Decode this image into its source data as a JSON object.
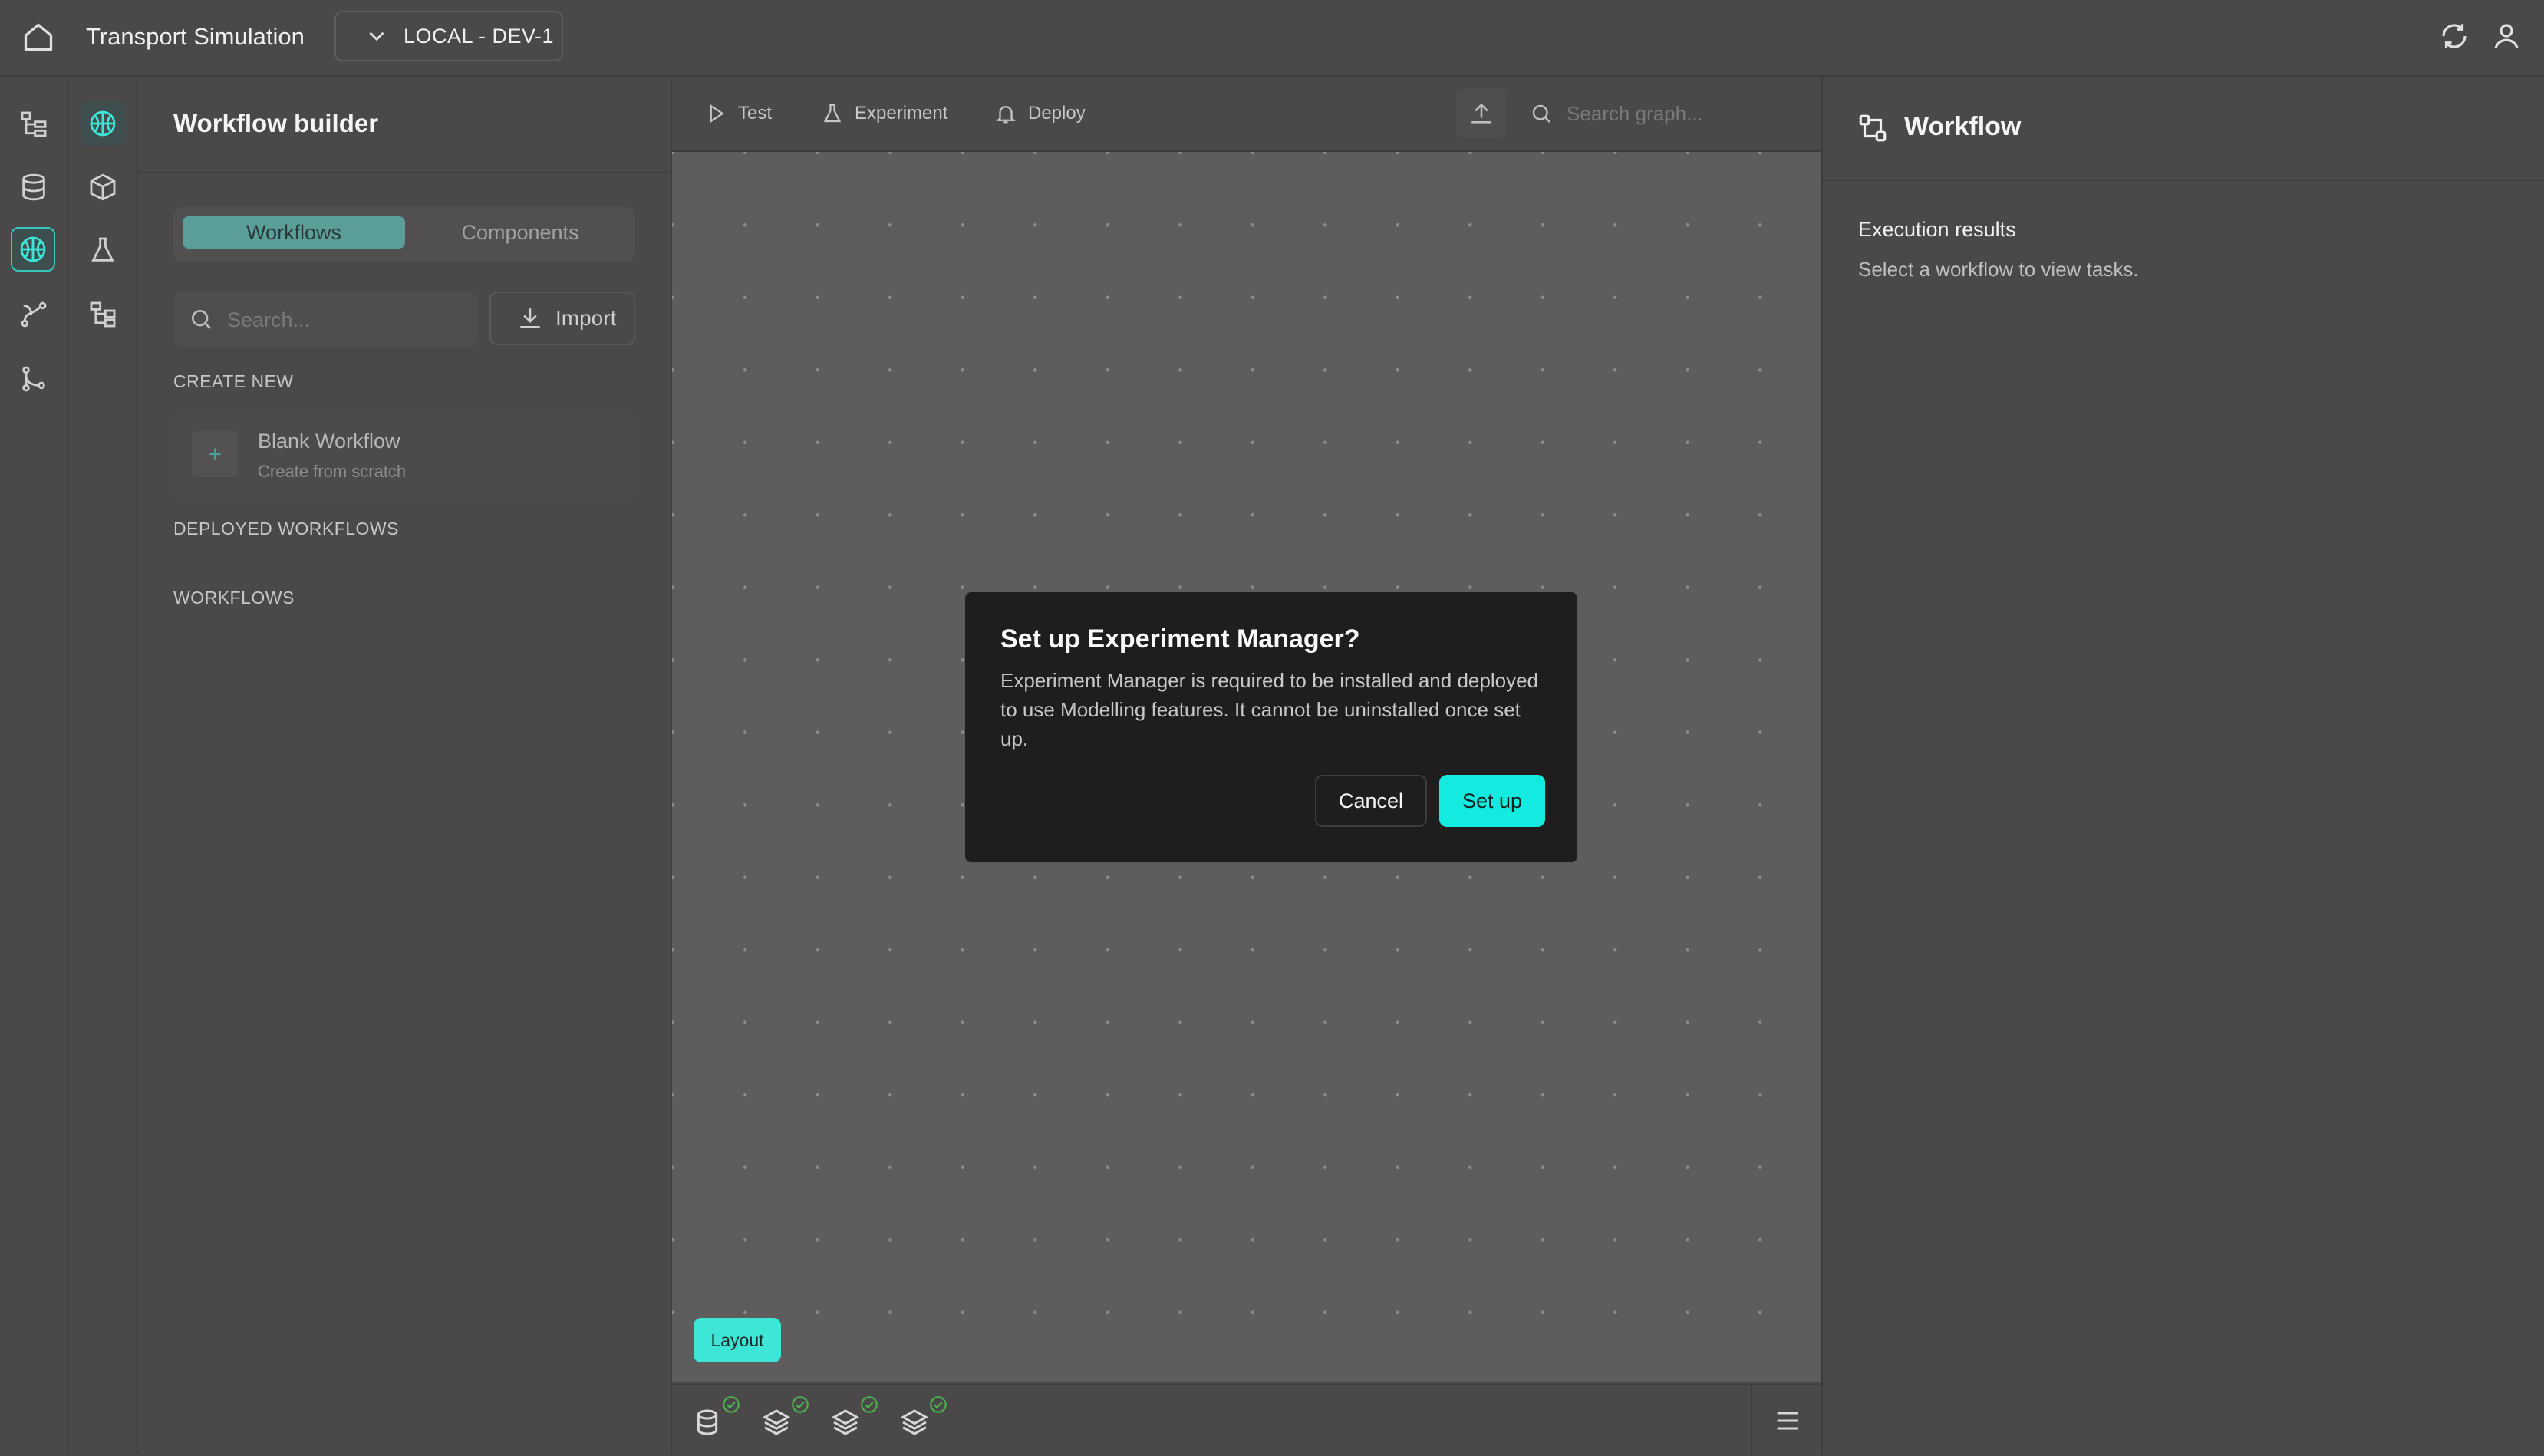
{
  "header": {
    "app_title": "Transport Simulation",
    "environment": "LOCAL - DEV-1",
    "icons": [
      "home-icon",
      "chevron-down-icon",
      "refresh-icon",
      "user-icon"
    ]
  },
  "rail1": {
    "icons": [
      "hierarchy-icon",
      "database-icon",
      "brain-icon",
      "branch-flow-icon",
      "git-branch-icon"
    ]
  },
  "rail2": {
    "icons": [
      "brain-icon",
      "cube-icon",
      "flask-icon",
      "tree-structure-icon"
    ]
  },
  "sidebar": {
    "title": "Workflow builder",
    "tabs": [
      {
        "label": "Workflows",
        "active": true
      },
      {
        "label": "Components",
        "active": false
      }
    ],
    "search_placeholder": "Search...",
    "import_label": "Import",
    "create_new_label": "CREATE NEW",
    "blank_workflow": {
      "title": "Blank Workflow",
      "subtitle": "Create from scratch"
    },
    "deployed_label": "DEPLOYED WORKFLOWS",
    "workflows_label": "WORKFLOWS"
  },
  "toolbar": {
    "test_label": "Test",
    "experiment_label": "Experiment",
    "deploy_label": "Deploy",
    "search_placeholder": "Search graph..."
  },
  "canvas": {
    "layout_label": "Layout"
  },
  "bottom_bar": {
    "icons": [
      "database-icon",
      "layers-icon",
      "layers-icon",
      "layers-icon"
    ],
    "status": "ok"
  },
  "right_panel": {
    "title": "Workflow",
    "section_label": "Execution results",
    "empty_text": "Select a workflow to view tasks."
  },
  "modal": {
    "title": "Set up Experiment Manager?",
    "body": "Experiment Manager is required to be installed and deployed to use Modelling features. It cannot be uninstalled once set up.",
    "cancel_label": "Cancel",
    "confirm_label": "Set up"
  },
  "colors": {
    "accent": "#14ebe0",
    "background": "#4a4849",
    "canvas": "#5f5c5e",
    "modal": "#1f1d1e",
    "check": "#4caf50"
  }
}
